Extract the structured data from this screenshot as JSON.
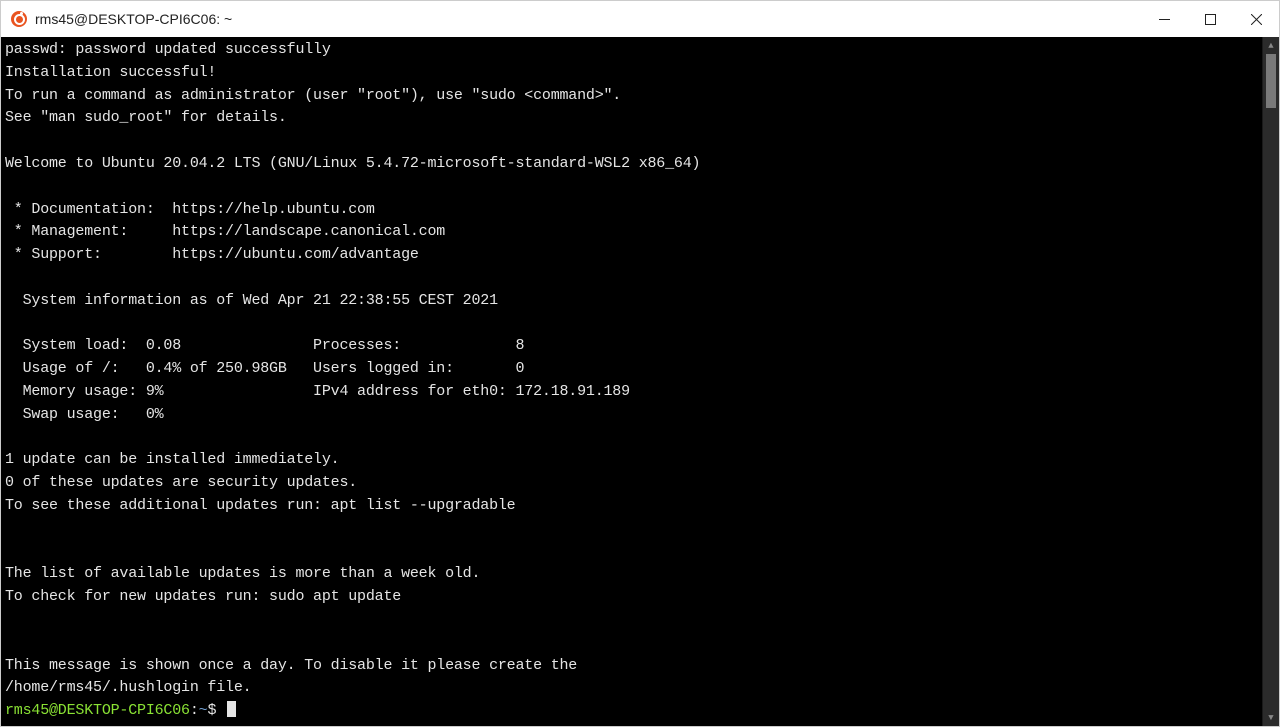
{
  "titlebar": {
    "title": "rms45@DESKTOP-CPI6C06: ~"
  },
  "terminal": {
    "lines": [
      "passwd: password updated successfully",
      "Installation successful!",
      "To run a command as administrator (user \"root\"), use \"sudo <command>\".",
      "See \"man sudo_root\" for details.",
      "",
      "Welcome to Ubuntu 20.04.2 LTS (GNU/Linux 5.4.72-microsoft-standard-WSL2 x86_64)",
      "",
      " * Documentation:  https://help.ubuntu.com",
      " * Management:     https://landscape.canonical.com",
      " * Support:        https://ubuntu.com/advantage",
      "",
      "  System information as of Wed Apr 21 22:38:55 CEST 2021",
      "",
      "  System load:  0.08               Processes:             8",
      "  Usage of /:   0.4% of 250.98GB   Users logged in:       0",
      "  Memory usage: 9%                 IPv4 address for eth0: 172.18.91.189",
      "  Swap usage:   0%",
      "",
      "1 update can be installed immediately.",
      "0 of these updates are security updates.",
      "To see these additional updates run: apt list --upgradable",
      "",
      "",
      "The list of available updates is more than a week old.",
      "To check for new updates run: sudo apt update",
      "",
      "",
      "This message is shown once a day. To disable it please create the",
      "/home/rms45/.hushlogin file."
    ],
    "prompt": {
      "user_host": "rms45@DESKTOP-CPI6C06",
      "separator": ":",
      "path": "~",
      "symbol": "$"
    }
  }
}
